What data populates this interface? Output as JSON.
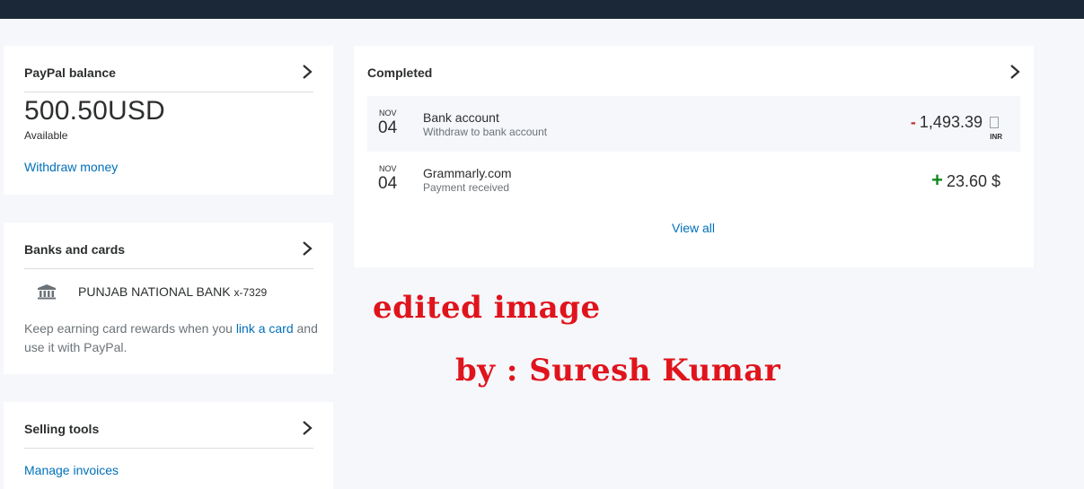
{
  "colors": {
    "topbar": "#1a2838",
    "link": "#0070ba",
    "minus": "#c72e2e",
    "plus": "#108a20",
    "watermark": "#e0141c"
  },
  "balance": {
    "title": "PayPal balance",
    "amount": "500.50USD",
    "label": "Available",
    "withdraw_link": "Withdraw money"
  },
  "banks": {
    "title": "Banks and cards",
    "bank_icon": "bank-icon",
    "bank_name": "PUNJAB NATIONAL BANK",
    "bank_number": "x-7329",
    "note_before": "Keep earning card rewards when you ",
    "note_link": "link a card",
    "note_after": " and use it with PayPal."
  },
  "selling": {
    "title": "Selling tools",
    "manage_link": "Manage invoices"
  },
  "activity": {
    "title": "Completed",
    "transactions": [
      {
        "month": "NOV",
        "day": "04",
        "title": "Bank account",
        "subtitle": "Withdraw to bank account",
        "sign": "-",
        "amount": "1,493.39",
        "currency": "INR"
      },
      {
        "month": "NOV",
        "day": "04",
        "title": "Grammarly.com",
        "subtitle": "Payment received",
        "sign": "+",
        "amount": "23.60 $"
      }
    ],
    "view_all": "View all"
  },
  "watermark": {
    "line1": "edited image",
    "line2": "by : Suresh Kumar"
  }
}
